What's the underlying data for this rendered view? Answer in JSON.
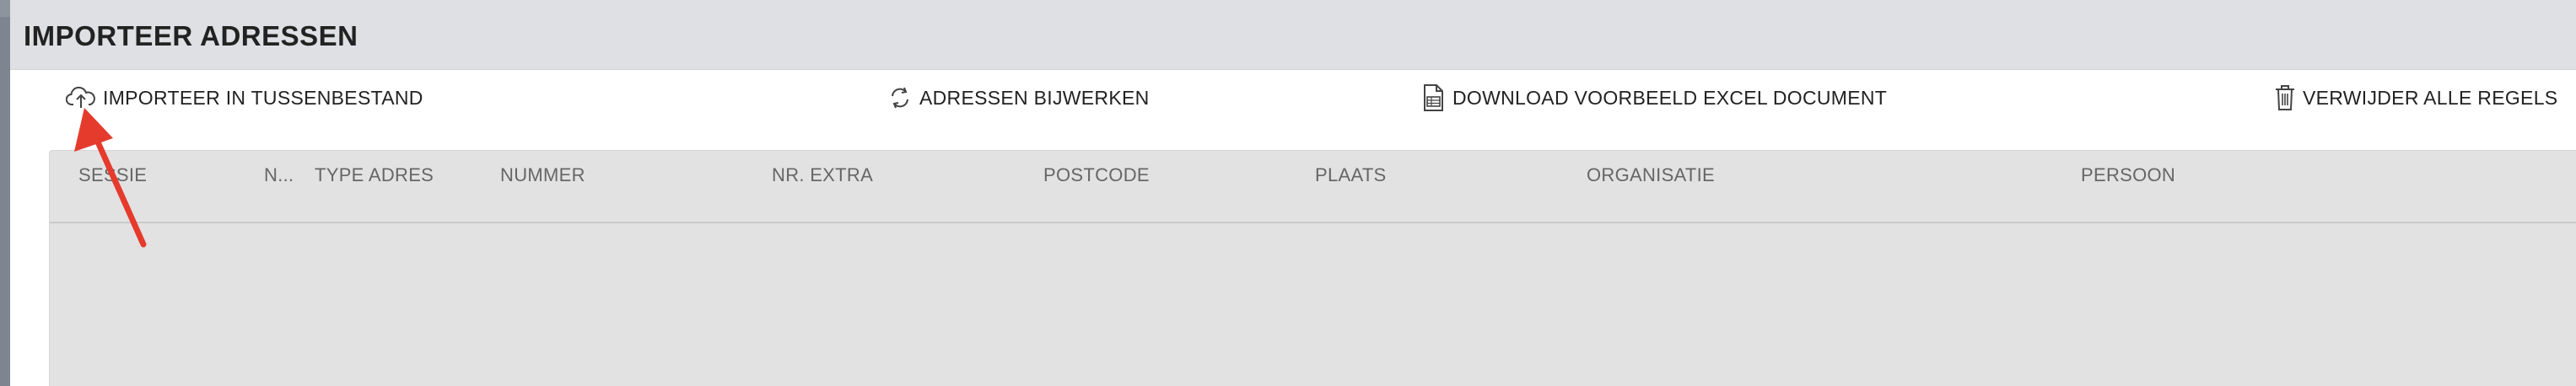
{
  "modal": {
    "title": "IMPORTEER ADRESSEN"
  },
  "toolbar": {
    "import_label": "IMPORTEER IN TUSSENBESTAND",
    "import_icon": "cloud-upload-icon",
    "update_label": "ADRESSEN BIJWERKEN",
    "update_icon": "refresh-icon",
    "download_label": "DOWNLOAD VOORBEELD EXCEL DOCUMENT",
    "download_icon": "document-icon",
    "delete_label": "VERWIJDER ALLE REGELS",
    "delete_icon": "trash-icon"
  },
  "table": {
    "columns": [
      "SESSIE",
      "N...",
      "TYPE ADRES",
      "NUMMER",
      "NR. EXTRA",
      "POSTCODE",
      "PLAATS",
      "ORGANISATIE",
      "PERSOON"
    ]
  },
  "colors": {
    "header_bg": "#dfe0e4",
    "grid_bg": "#e2e2e2",
    "annotation_arrow": "#e53b2c"
  }
}
